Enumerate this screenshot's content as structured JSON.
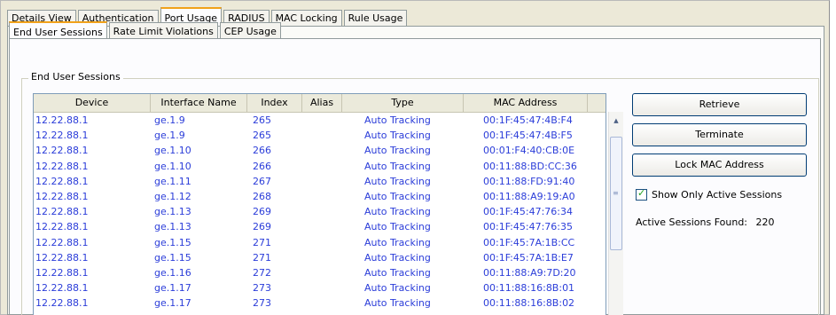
{
  "main_tabs": [
    "Details View",
    "Authentication",
    "Port Usage",
    "RADIUS",
    "MAC Locking",
    "Rule Usage"
  ],
  "main_active": "Port Usage",
  "sub_tabs": [
    "End User Sessions",
    "Rate Limit Violations",
    "CEP Usage"
  ],
  "sub_active": "End User Sessions",
  "group_title": "End User Sessions",
  "table": {
    "columns": [
      "Device",
      "Interface Name",
      "Index",
      "Alias",
      "Type",
      "MAC Address"
    ],
    "rows": [
      [
        "12.22.88.1",
        "ge.1.9",
        "265",
        "",
        "Auto Tracking",
        "00:1F:45:47:4B:F4"
      ],
      [
        "12.22.88.1",
        "ge.1.9",
        "265",
        "",
        "Auto Tracking",
        "00:1F:45:47:4B:F5"
      ],
      [
        "12.22.88.1",
        "ge.1.10",
        "266",
        "",
        "Auto Tracking",
        "00:01:F4:40:CB:0E"
      ],
      [
        "12.22.88.1",
        "ge.1.10",
        "266",
        "",
        "Auto Tracking",
        "00:11:88:BD:CC:36"
      ],
      [
        "12.22.88.1",
        "ge.1.11",
        "267",
        "",
        "Auto Tracking",
        "00:11:88:FD:91:40"
      ],
      [
        "12.22.88.1",
        "ge.1.12",
        "268",
        "",
        "Auto Tracking",
        "00:11:88:A9:19:A0"
      ],
      [
        "12.22.88.1",
        "ge.1.13",
        "269",
        "",
        "Auto Tracking",
        "00:1F:45:47:76:34"
      ],
      [
        "12.22.88.1",
        "ge.1.13",
        "269",
        "",
        "Auto Tracking",
        "00:1F:45:47:76:35"
      ],
      [
        "12.22.88.1",
        "ge.1.15",
        "271",
        "",
        "Auto Tracking",
        "00:1F:45:7A:1B:CC"
      ],
      [
        "12.22.88.1",
        "ge.1.15",
        "271",
        "",
        "Auto Tracking",
        "00:1F:45:7A:1B:E7"
      ],
      [
        "12.22.88.1",
        "ge.1.16",
        "272",
        "",
        "Auto Tracking",
        "00:11:88:A9:7D:20"
      ],
      [
        "12.22.88.1",
        "ge.1.17",
        "273",
        "",
        "Auto Tracking",
        "00:11:88:16:8B:01"
      ],
      [
        "12.22.88.1",
        "ge.1.17",
        "273",
        "",
        "Auto Tracking",
        "00:11:88:16:8B:02"
      ]
    ]
  },
  "buttons": {
    "retrieve": "Retrieve",
    "terminate": "Terminate",
    "lock_mac": "Lock MAC Address"
  },
  "show_only_active": {
    "label": "Show Only Active Sessions",
    "checked": true
  },
  "active_sessions": {
    "label": "Active Sessions Found:",
    "count": "220"
  },
  "colors": {
    "cell_text": "#2b3dd9",
    "active_tab_accent": "#f1a21b",
    "button_border": "#003c74"
  }
}
